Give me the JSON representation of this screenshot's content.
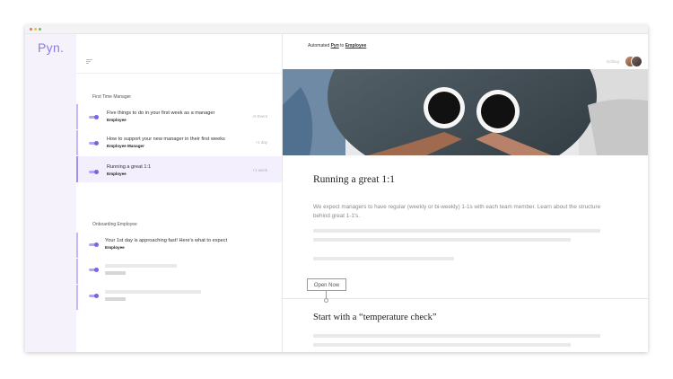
{
  "app": {
    "logo": "Pyn."
  },
  "window": {
    "dot_colors": [
      "#ec6b5f",
      "#f4bf4f",
      "#61c554"
    ]
  },
  "sections": [
    {
      "title": "First Time Manager",
      "items": [
        {
          "title": "Five things to do in your first week as a manager",
          "role": "Employee",
          "time": "At Event"
        },
        {
          "title": "How to support your new manager in their first weeks",
          "role": "Employee Manager",
          "time": "+1 day"
        },
        {
          "title": "Running a great 1:1",
          "role": "Employee",
          "time": "+1 week",
          "active": true
        }
      ]
    },
    {
      "title": "Onboarding Employee",
      "items": [
        {
          "title": "Your 1st day is approaching fast! Here's what to expect",
          "role": "Employee"
        }
      ]
    }
  ],
  "main": {
    "breadcrumb": {
      "prefix": "Automated",
      "link1": "Pyn",
      "middle": "to",
      "link2": "Employee"
    },
    "editing_label": "Editing",
    "card": {
      "title": "Running a great 1:1",
      "body": "We expect managers to have regular (weekly or bi-weekly) 1-1s with each team member. Learn about the structure behind great 1-1's."
    },
    "open_button": "Open Now",
    "card2_title": "Start with a “temperature check”"
  },
  "colors": {
    "accent": "#7a62e6",
    "logo": "#8b7be6",
    "sidebar_bg": "#f5f2fb",
    "active_row": "#f3effd"
  }
}
